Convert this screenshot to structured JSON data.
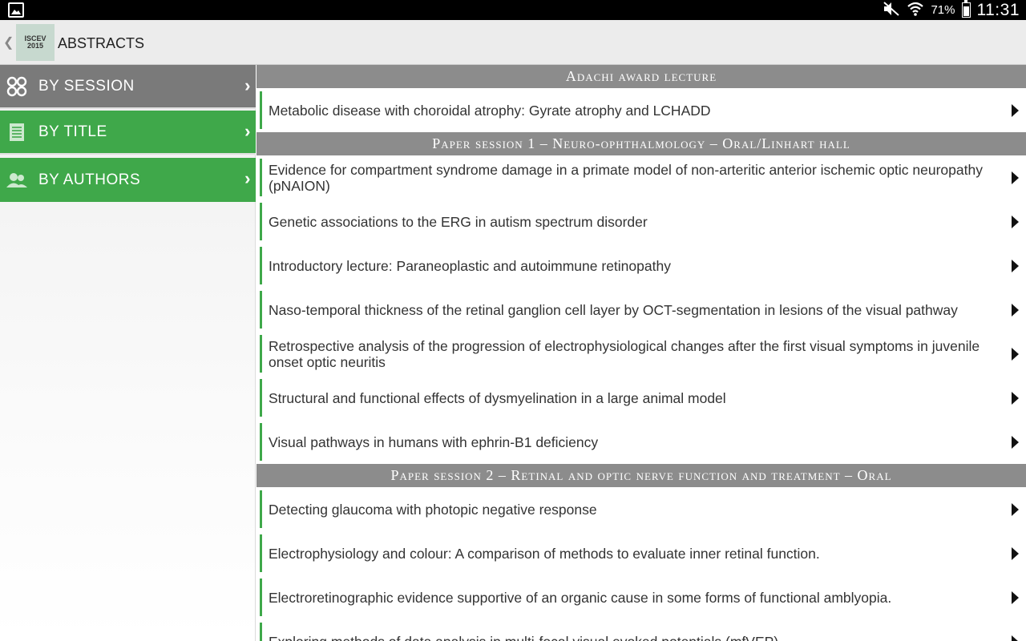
{
  "status_bar": {
    "battery": "71%",
    "time": "11:31",
    "icons": [
      "gallery-icon",
      "mute-icon",
      "wifi-icon",
      "battery-icon"
    ]
  },
  "action_bar": {
    "logo_line1": "ISCEV",
    "logo_line2": "2015",
    "title": "ABSTRACTS"
  },
  "sidebar": {
    "items": [
      {
        "label": "BY SESSION",
        "icon": "grid-icon"
      },
      {
        "label": "BY TITLE",
        "icon": "list-icon"
      },
      {
        "label": "BY AUTHORS",
        "icon": "people-icon"
      }
    ]
  },
  "sections": [
    {
      "header": "Adachi award lecture",
      "items": [
        "Metabolic disease with choroidal atrophy: Gyrate atrophy and LCHADD"
      ]
    },
    {
      "header": "Paper session 1 – Neuro-ophthalmology – Oral/Linhart hall",
      "items": [
        "Evidence for compartment syndrome damage in a primate model of non-arteritic anterior ischemic optic neuropathy (pNAION)",
        "Genetic associations to the ERG in autism spectrum disorder",
        "Introductory lecture: Paraneoplastic and autoimmune retinopathy",
        "Naso-temporal thickness of the retinal ganglion cell layer by OCT-segmentation in lesions of the visual pathway",
        "Retrospective analysis of the progression of electrophysiological changes after the first visual symptoms in juvenile onset optic neuritis",
        "Structural and functional effects of dysmyelination in a large animal model",
        "Visual pathways in humans with ephrin-B1 deficiency"
      ]
    },
    {
      "header": "Paper session 2 – Retinal and optic nerve function and treatment – Oral",
      "items": [
        "Detecting glaucoma with photopic negative response",
        "Electrophysiology and colour: A comparison of methods to evaluate inner retinal function.",
        "Electroretinographic evidence supportive of an organic cause in some forms of functional amblyopia.",
        "Exploring methods of data analysis in multi-focal visual evoked potentials (mfVEP)"
      ]
    }
  ]
}
